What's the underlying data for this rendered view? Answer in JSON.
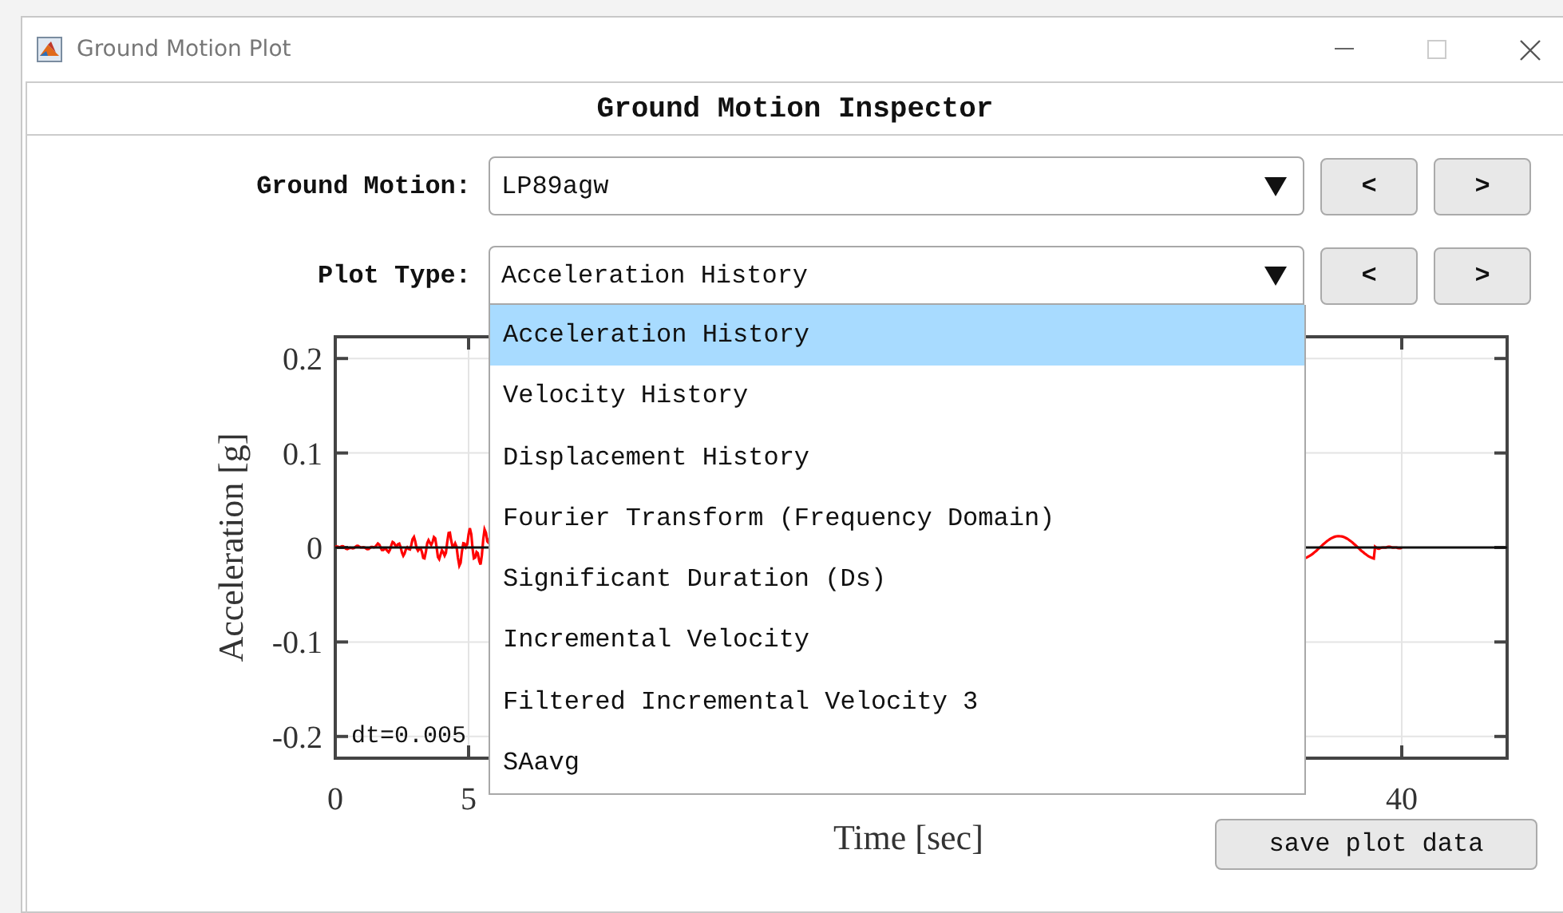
{
  "window": {
    "title": "Ground Motion Plot"
  },
  "header": "Ground Motion Inspector",
  "controls": [
    {
      "label": "Ground Motion:",
      "value": "LP89agw",
      "prev": "<",
      "next": ">",
      "expanded": false
    },
    {
      "label": "Plot Type:",
      "value": "Acceleration History",
      "prev": "<",
      "next": ">",
      "expanded": true,
      "options": [
        {
          "label": "Acceleration History",
          "selected": true
        },
        {
          "label": "Velocity History",
          "selected": false
        },
        {
          "label": "Displacement History",
          "selected": false
        },
        {
          "label": "Fourier Transform (Frequency Domain)",
          "selected": false
        },
        {
          "label": "Significant Duration (Ds)",
          "selected": false
        },
        {
          "label": "Incremental Velocity",
          "selected": false
        },
        {
          "label": "Filtered Incremental Velocity 3",
          "selected": false
        },
        {
          "label": "SAavg",
          "selected": false
        }
      ]
    }
  ],
  "plot": {
    "xlabel": "Time [sec]",
    "ylabel": "Acceleration [g]",
    "xticks": [
      "0",
      "5",
      "40"
    ],
    "yticks": [
      "0.2",
      "0.1",
      "0",
      "-0.1",
      "-0.2"
    ],
    "note": "dt=0.005"
  },
  "save_button": "save plot data"
}
